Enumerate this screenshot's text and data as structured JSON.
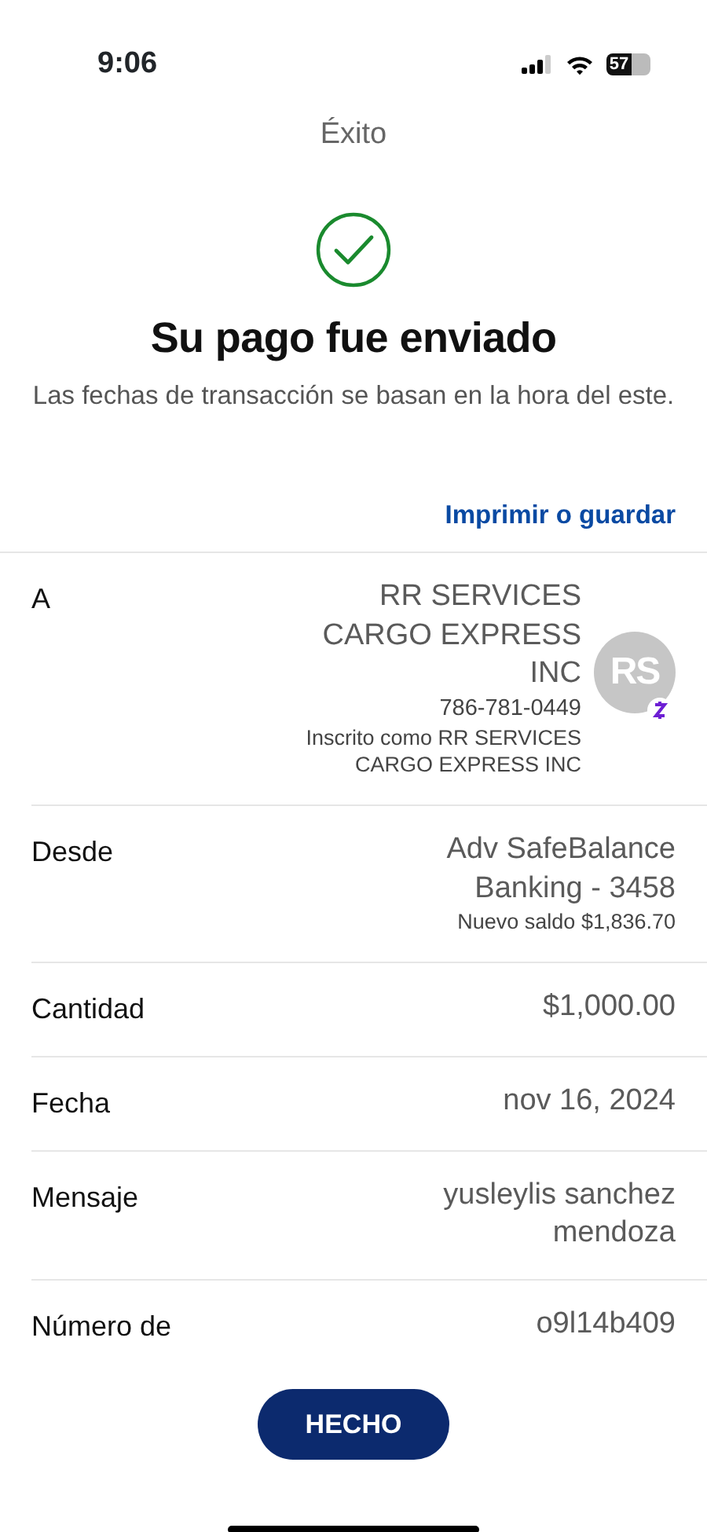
{
  "status_bar": {
    "time": "9:06",
    "battery": "57"
  },
  "header": {
    "title": "Éxito"
  },
  "result": {
    "heading": "Su pago fue enviado",
    "note": "Las fechas de transacción se basan en la hora del este."
  },
  "print_link": "Imprimir o guardar",
  "details": [
    {
      "kind": "recipient",
      "label": "A",
      "value": "RR SERVICES CARGO EXPRESS INC",
      "phone": "786-781-0449",
      "enrolled": "Inscrito como RR SERVICES CARGO EXPRESS INC",
      "avatar": "RS"
    },
    {
      "kind": "account",
      "label": "Desde",
      "value": "Adv SafeBalance Banking - 3458",
      "sub": "Nuevo saldo $1,836.70"
    },
    {
      "kind": "plain",
      "label": "Cantidad",
      "value": "$1,000.00"
    },
    {
      "kind": "plain",
      "label": "Fecha",
      "value": "nov 16, 2024"
    },
    {
      "kind": "plain",
      "label": "Mensaje",
      "value": "yusleylis sanchez mendoza"
    },
    {
      "kind": "plain",
      "label": "Número de",
      "value": "o9l14b409"
    }
  ],
  "done_button": "HECHO"
}
